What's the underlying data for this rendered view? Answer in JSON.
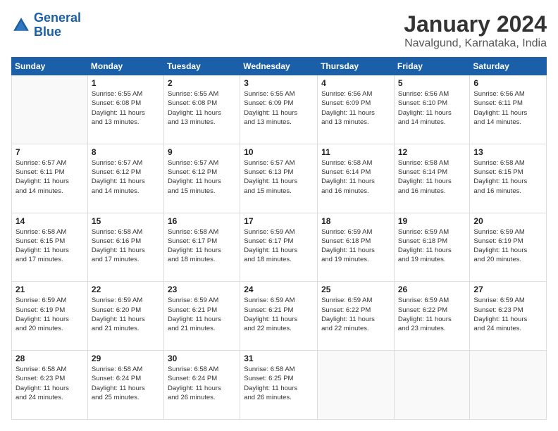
{
  "logo": {
    "line1": "General",
    "line2": "Blue"
  },
  "title": "January 2024",
  "subtitle": "Navalgund, Karnataka, India",
  "weekdays": [
    "Sunday",
    "Monday",
    "Tuesday",
    "Wednesday",
    "Thursday",
    "Friday",
    "Saturday"
  ],
  "weeks": [
    [
      {
        "day": "",
        "info": ""
      },
      {
        "day": "1",
        "info": "Sunrise: 6:55 AM\nSunset: 6:08 PM\nDaylight: 11 hours\nand 13 minutes."
      },
      {
        "day": "2",
        "info": "Sunrise: 6:55 AM\nSunset: 6:08 PM\nDaylight: 11 hours\nand 13 minutes."
      },
      {
        "day": "3",
        "info": "Sunrise: 6:55 AM\nSunset: 6:09 PM\nDaylight: 11 hours\nand 13 minutes."
      },
      {
        "day": "4",
        "info": "Sunrise: 6:56 AM\nSunset: 6:09 PM\nDaylight: 11 hours\nand 13 minutes."
      },
      {
        "day": "5",
        "info": "Sunrise: 6:56 AM\nSunset: 6:10 PM\nDaylight: 11 hours\nand 14 minutes."
      },
      {
        "day": "6",
        "info": "Sunrise: 6:56 AM\nSunset: 6:11 PM\nDaylight: 11 hours\nand 14 minutes."
      }
    ],
    [
      {
        "day": "7",
        "info": "Sunrise: 6:57 AM\nSunset: 6:11 PM\nDaylight: 11 hours\nand 14 minutes."
      },
      {
        "day": "8",
        "info": "Sunrise: 6:57 AM\nSunset: 6:12 PM\nDaylight: 11 hours\nand 14 minutes."
      },
      {
        "day": "9",
        "info": "Sunrise: 6:57 AM\nSunset: 6:12 PM\nDaylight: 11 hours\nand 15 minutes."
      },
      {
        "day": "10",
        "info": "Sunrise: 6:57 AM\nSunset: 6:13 PM\nDaylight: 11 hours\nand 15 minutes."
      },
      {
        "day": "11",
        "info": "Sunrise: 6:58 AM\nSunset: 6:14 PM\nDaylight: 11 hours\nand 16 minutes."
      },
      {
        "day": "12",
        "info": "Sunrise: 6:58 AM\nSunset: 6:14 PM\nDaylight: 11 hours\nand 16 minutes."
      },
      {
        "day": "13",
        "info": "Sunrise: 6:58 AM\nSunset: 6:15 PM\nDaylight: 11 hours\nand 16 minutes."
      }
    ],
    [
      {
        "day": "14",
        "info": "Sunrise: 6:58 AM\nSunset: 6:15 PM\nDaylight: 11 hours\nand 17 minutes."
      },
      {
        "day": "15",
        "info": "Sunrise: 6:58 AM\nSunset: 6:16 PM\nDaylight: 11 hours\nand 17 minutes."
      },
      {
        "day": "16",
        "info": "Sunrise: 6:58 AM\nSunset: 6:17 PM\nDaylight: 11 hours\nand 18 minutes."
      },
      {
        "day": "17",
        "info": "Sunrise: 6:59 AM\nSunset: 6:17 PM\nDaylight: 11 hours\nand 18 minutes."
      },
      {
        "day": "18",
        "info": "Sunrise: 6:59 AM\nSunset: 6:18 PM\nDaylight: 11 hours\nand 19 minutes."
      },
      {
        "day": "19",
        "info": "Sunrise: 6:59 AM\nSunset: 6:18 PM\nDaylight: 11 hours\nand 19 minutes."
      },
      {
        "day": "20",
        "info": "Sunrise: 6:59 AM\nSunset: 6:19 PM\nDaylight: 11 hours\nand 20 minutes."
      }
    ],
    [
      {
        "day": "21",
        "info": "Sunrise: 6:59 AM\nSunset: 6:19 PM\nDaylight: 11 hours\nand 20 minutes."
      },
      {
        "day": "22",
        "info": "Sunrise: 6:59 AM\nSunset: 6:20 PM\nDaylight: 11 hours\nand 21 minutes."
      },
      {
        "day": "23",
        "info": "Sunrise: 6:59 AM\nSunset: 6:21 PM\nDaylight: 11 hours\nand 21 minutes."
      },
      {
        "day": "24",
        "info": "Sunrise: 6:59 AM\nSunset: 6:21 PM\nDaylight: 11 hours\nand 22 minutes."
      },
      {
        "day": "25",
        "info": "Sunrise: 6:59 AM\nSunset: 6:22 PM\nDaylight: 11 hours\nand 22 minutes."
      },
      {
        "day": "26",
        "info": "Sunrise: 6:59 AM\nSunset: 6:22 PM\nDaylight: 11 hours\nand 23 minutes."
      },
      {
        "day": "27",
        "info": "Sunrise: 6:59 AM\nSunset: 6:23 PM\nDaylight: 11 hours\nand 24 minutes."
      }
    ],
    [
      {
        "day": "28",
        "info": "Sunrise: 6:58 AM\nSunset: 6:23 PM\nDaylight: 11 hours\nand 24 minutes."
      },
      {
        "day": "29",
        "info": "Sunrise: 6:58 AM\nSunset: 6:24 PM\nDaylight: 11 hours\nand 25 minutes."
      },
      {
        "day": "30",
        "info": "Sunrise: 6:58 AM\nSunset: 6:24 PM\nDaylight: 11 hours\nand 26 minutes."
      },
      {
        "day": "31",
        "info": "Sunrise: 6:58 AM\nSunset: 6:25 PM\nDaylight: 11 hours\nand 26 minutes."
      },
      {
        "day": "",
        "info": ""
      },
      {
        "day": "",
        "info": ""
      },
      {
        "day": "",
        "info": ""
      }
    ]
  ]
}
